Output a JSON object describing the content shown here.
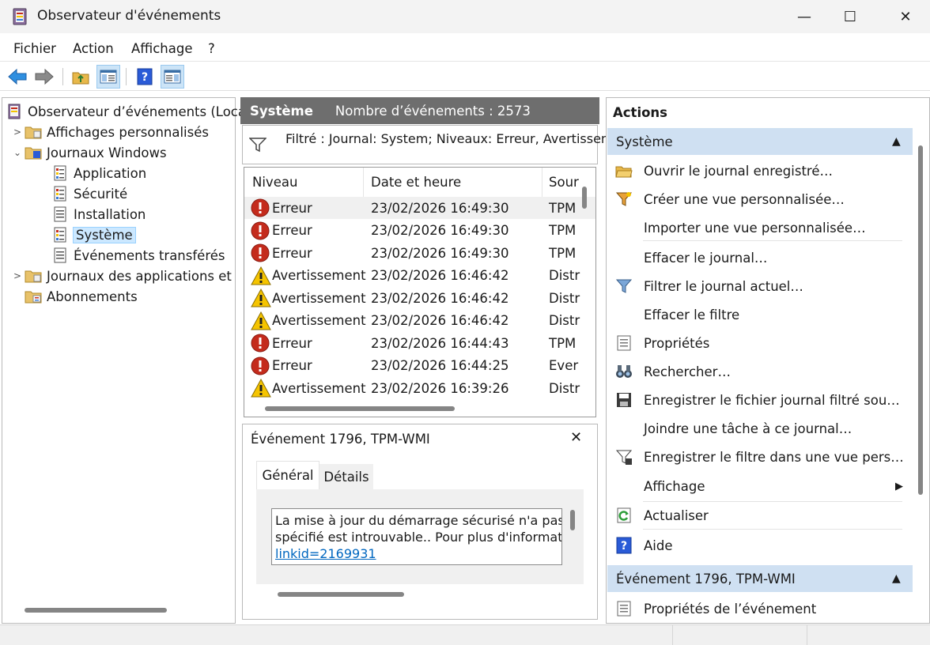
{
  "window": {
    "title": "Observateur d'événements",
    "minimize_glyph": "—",
    "maximize_glyph": "☐",
    "close_glyph": "✕"
  },
  "menu": {
    "items": [
      "Fichier",
      "Action",
      "Affichage",
      "?"
    ]
  },
  "toolbar": {
    "icons": [
      "back-arrow-icon",
      "forward-arrow-icon",
      "folder-up-icon",
      "show-hide-tree-icon",
      "help-icon",
      "show-hide-action-pane-icon"
    ]
  },
  "tree": {
    "root": "Observateur d’événements (Loca",
    "custom_views": "Affichages personnalisés",
    "windows_logs": "Journaux Windows",
    "logs": [
      "Application",
      "Sécurité",
      "Installation",
      "Système",
      "Événements transférés"
    ],
    "app_logs": "Journaux des applications et",
    "subscriptions": "Abonnements"
  },
  "center": {
    "header_title": "Système",
    "header_count": "Nombre d’événements : 2573",
    "filter_text": "Filtré : Journal: System; Niveaux: Erreur, Avertissem",
    "columns": {
      "level": "Niveau",
      "date": "Date et heure",
      "source": "Sour"
    },
    "rows": [
      {
        "icon": "error",
        "level": "Erreur",
        "date": "23/02/2026 16:49:30",
        "source": "TPM"
      },
      {
        "icon": "error",
        "level": "Erreur",
        "date": "23/02/2026 16:49:30",
        "source": "TPM"
      },
      {
        "icon": "error",
        "level": "Erreur",
        "date": "23/02/2026 16:49:30",
        "source": "TPM"
      },
      {
        "icon": "warning",
        "level": "Avertissement",
        "date": "23/02/2026 16:46:42",
        "source": "Distr"
      },
      {
        "icon": "warning",
        "level": "Avertissement",
        "date": "23/02/2026 16:46:42",
        "source": "Distr"
      },
      {
        "icon": "warning",
        "level": "Avertissement",
        "date": "23/02/2026 16:46:42",
        "source": "Distr"
      },
      {
        "icon": "error",
        "level": "Erreur",
        "date": "23/02/2026 16:44:43",
        "source": "TPM"
      },
      {
        "icon": "error",
        "level": "Erreur",
        "date": "23/02/2026 16:44:25",
        "source": "Ever"
      },
      {
        "icon": "warning",
        "level": "Avertissement",
        "date": "23/02/2026 16:39:26",
        "source": "Distr"
      }
    ]
  },
  "detail": {
    "title": "Événement 1796, TPM-WMI",
    "close_glyph": "✕",
    "tabs": [
      "Général",
      "Détails"
    ],
    "line1": "La mise à jour du démarrage sécurisé n'a pas p",
    "line2": "spécifié est introuvable.. Pour plus d'informati",
    "link": "linkid=2169931"
  },
  "actions": {
    "header": "Actions",
    "section1": "Système",
    "items": [
      {
        "label": "Ouvrir le journal enregistré…",
        "icon": "open-folder-icon"
      },
      {
        "label": "Créer une vue personnalisée…",
        "icon": "create-filter-icon"
      },
      {
        "label": "Importer une vue personnalisée…",
        "icon": ""
      },
      {
        "label": "Effacer le journal…",
        "icon": ""
      },
      {
        "label": "Filtrer le journal actuel…",
        "icon": "filter-icon"
      },
      {
        "label": "Effacer le filtre",
        "icon": ""
      },
      {
        "label": "Propriétés",
        "icon": "properties-icon"
      },
      {
        "label": "Rechercher…",
        "icon": "binoculars-icon"
      },
      {
        "label": "Enregistrer le fichier journal filtré sou…",
        "icon": "save-icon"
      },
      {
        "label": "Joindre une tâche à ce journal…",
        "icon": ""
      },
      {
        "label": "Enregistrer le filtre dans une vue pers…",
        "icon": "save-filter-icon"
      },
      {
        "label": "Affichage",
        "icon": ""
      },
      {
        "label": "Actualiser",
        "icon": "refresh-icon"
      },
      {
        "label": "Aide",
        "icon": "help-icon"
      }
    ],
    "section2": "Événement 1796, TPM-WMI",
    "event_props": "Propriétés de l’événement"
  },
  "colors": {
    "accent_blue": "#0067c0",
    "error_red": "#c42b1c",
    "warning_yellow": "#f5c400",
    "section_blue": "#cfe0f2",
    "header_gray": "#6e6e6e"
  }
}
